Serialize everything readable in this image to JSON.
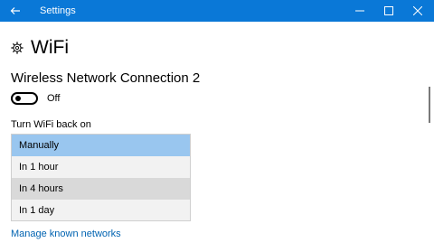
{
  "window": {
    "title": "Settings",
    "accent_color": "#0a78d7"
  },
  "page": {
    "title": "WiFi",
    "icon": "gear-icon"
  },
  "network": {
    "name": "Wireless Network Connection 2",
    "toggle_state": "Off"
  },
  "turn_back_on": {
    "label": "Turn WiFi back on",
    "options": [
      "Manually",
      "In 1 hour",
      "In 4 hours",
      "In 1 day"
    ],
    "selected": "Manually",
    "highlighted": "In 4 hours"
  },
  "links": {
    "manage_networks": "Manage known networks"
  }
}
